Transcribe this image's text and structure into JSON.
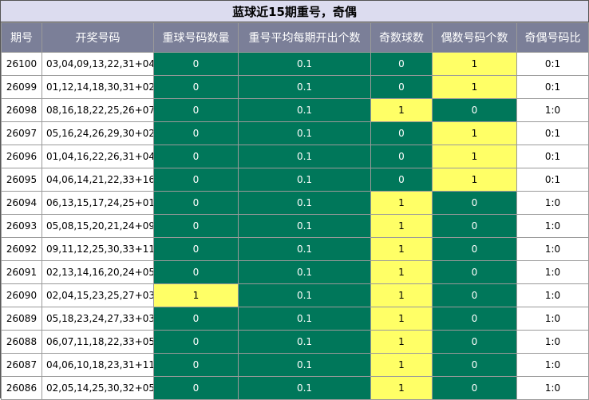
{
  "title": "蓝球近15期重号，奇偶",
  "colors": {
    "header_bg": "#7b7f98",
    "title_bg": "#dcdcef",
    "green": "#00775a",
    "yellow": "#ffff66"
  },
  "headers": [
    "期号",
    "开奖号码",
    "重球号码数量",
    "重号平均每期开出个数",
    "奇数球数",
    "偶数号码个数",
    "奇偶号码比"
  ],
  "chart_data": {
    "type": "table",
    "title": "蓝球近15期重号，奇偶",
    "columns": [
      "期号",
      "开奖号码",
      "重球号码数量",
      "重号平均每期开出个数",
      "奇数球数",
      "偶数号码个数",
      "奇偶号码比"
    ],
    "rows": [
      [
        "26100",
        "03,04,09,13,22,31+04",
        "0",
        "0.1",
        "0",
        "1",
        "0:1"
      ],
      [
        "26099",
        "01,12,14,18,30,31+02",
        "0",
        "0.1",
        "0",
        "1",
        "0:1"
      ],
      [
        "26098",
        "08,16,18,22,25,26+07",
        "0",
        "0.1",
        "1",
        "0",
        "1:0"
      ],
      [
        "26097",
        "05,16,24,26,29,30+02",
        "0",
        "0.1",
        "0",
        "1",
        "0:1"
      ],
      [
        "26096",
        "01,04,16,22,26,31+04",
        "0",
        "0.1",
        "0",
        "1",
        "0:1"
      ],
      [
        "26095",
        "04,06,14,21,22,33+16",
        "0",
        "0.1",
        "0",
        "1",
        "0:1"
      ],
      [
        "26094",
        "06,13,15,17,24,25+01",
        "0",
        "0.1",
        "1",
        "0",
        "1:0"
      ],
      [
        "26093",
        "05,08,15,20,21,24+09",
        "0",
        "0.1",
        "1",
        "0",
        "1:0"
      ],
      [
        "26092",
        "09,11,12,25,30,33+11",
        "0",
        "0.1",
        "1",
        "0",
        "1:0"
      ],
      [
        "26091",
        "02,13,14,16,20,24+05",
        "0",
        "0.1",
        "1",
        "0",
        "1:0"
      ],
      [
        "26090",
        "02,04,15,23,25,27+03",
        "1",
        "0.1",
        "1",
        "0",
        "1:0"
      ],
      [
        "26089",
        "05,18,23,24,27,33+03",
        "0",
        "0.1",
        "1",
        "0",
        "1:0"
      ],
      [
        "26088",
        "06,07,11,18,22,33+05",
        "0",
        "0.1",
        "1",
        "0",
        "1:0"
      ],
      [
        "26087",
        "04,06,10,18,23,31+11",
        "0",
        "0.1",
        "1",
        "0",
        "1:0"
      ],
      [
        "26086",
        "02,05,14,25,30,32+05",
        "0",
        "0.1",
        "1",
        "0",
        "1:0"
      ]
    ]
  }
}
